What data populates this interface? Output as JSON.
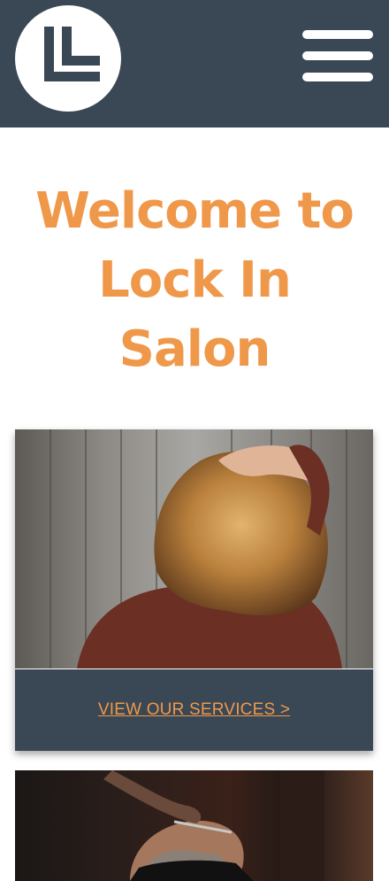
{
  "header": {
    "logo_icon": "lock-in-logo-icon",
    "menu_icon": "hamburger-menu-icon",
    "background_color": "#3a4754"
  },
  "hero": {
    "title_lines": [
      "Welcome to",
      "Lock In",
      "Salon"
    ],
    "title_color": "#f0984a"
  },
  "cards": [
    {
      "image": "woman-with-blonde-wavy-hair-photo",
      "link_label": "VIEW OUR SERVICES >"
    },
    {
      "image": "barber-trimming-beard-photo"
    }
  ]
}
